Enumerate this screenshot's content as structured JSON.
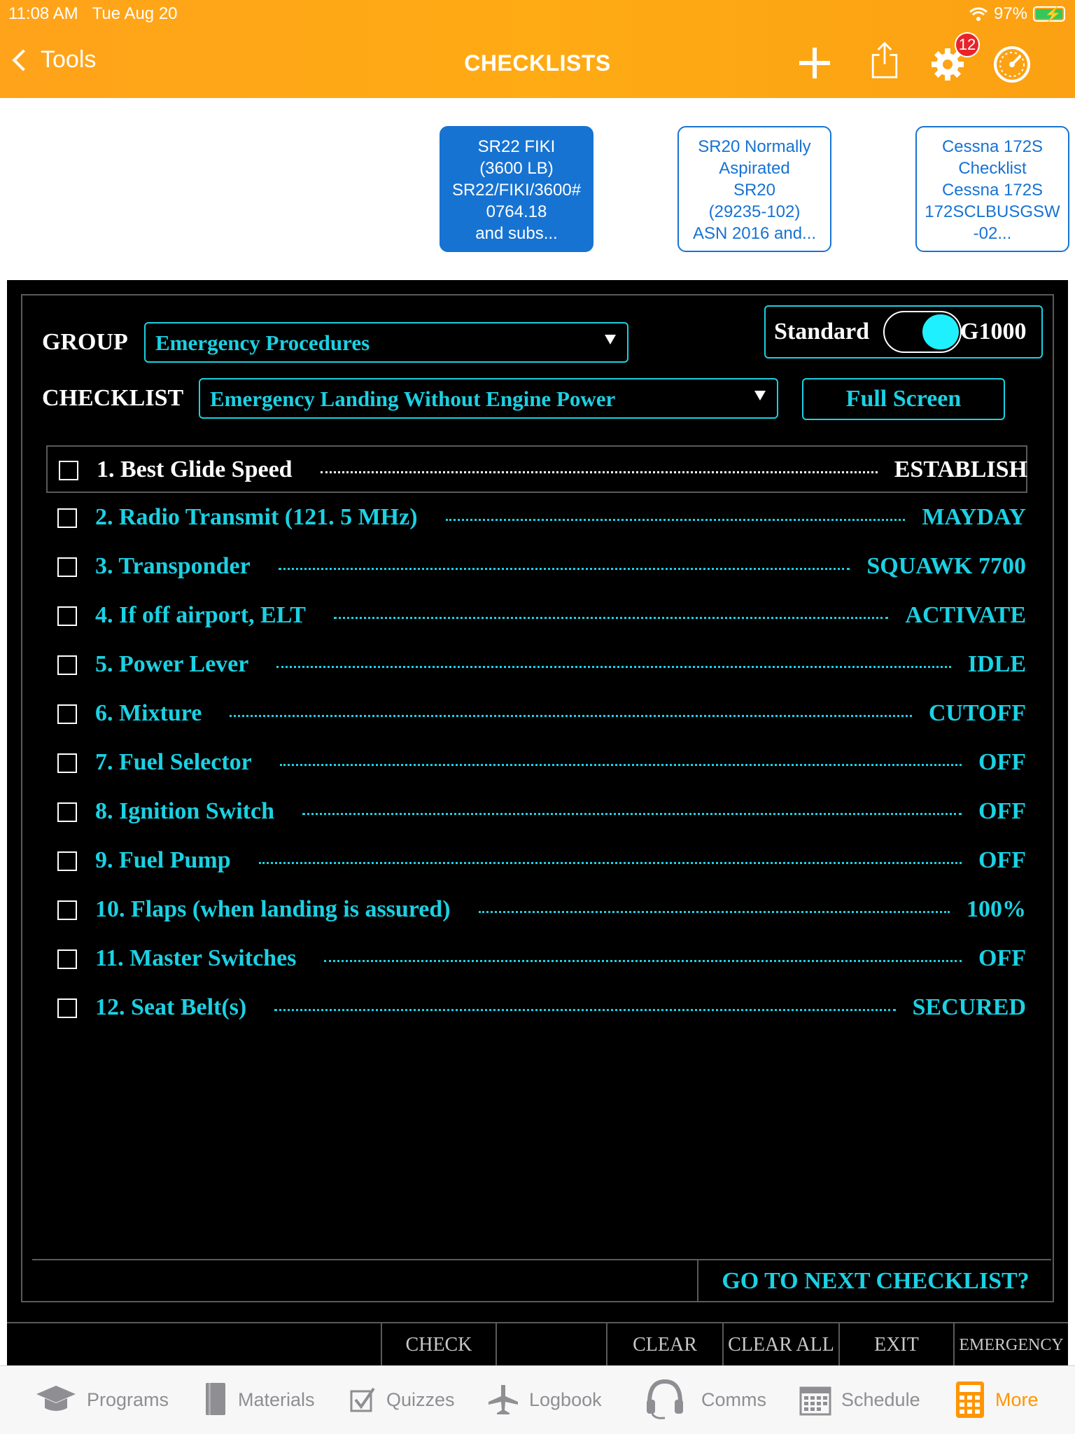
{
  "status": {
    "time": "11:08 AM",
    "date": "Tue Aug 20",
    "battery": "97%"
  },
  "nav": {
    "back_label": "Tools",
    "title": "CHECKLISTS",
    "settings_badge": "12"
  },
  "cards": [
    {
      "lines": [
        "SR22 FIKI",
        "(3600 LB)",
        "SR22/FIKI/3600#",
        "0764.18",
        "and subs..."
      ],
      "active": true
    },
    {
      "lines": [
        "SR20 Normally",
        "Aspirated",
        "SR20",
        "(29235-102)",
        "ASN 2016 and..."
      ],
      "active": false
    },
    {
      "lines": [
        "Cessna 172S",
        "Checklist",
        "Cessna 172S",
        "172SCLBUSGSW",
        "-02..."
      ],
      "active": false
    }
  ],
  "panel": {
    "group_label": "GROUP",
    "group_value": "Emergency Procedures",
    "checklist_label": "CHECKLIST",
    "checklist_value": "Emergency Landing Without Engine Power",
    "toggle_left": "Standard",
    "toggle_right": "G1000",
    "full_screen_label": "Full Screen",
    "items": [
      {
        "name": "1. Best Glide Speed",
        "value": "ESTABLISH",
        "checked": false
      },
      {
        "name": "2. Radio Transmit (121. 5 MHz)",
        "value": "MAYDAY",
        "checked": false
      },
      {
        "name": "3. Transponder",
        "value": "SQUAWK 7700",
        "checked": false
      },
      {
        "name": "4. If off airport, ELT",
        "value": "ACTIVATE",
        "checked": false
      },
      {
        "name": "5. Power Lever",
        "value": "IDLE",
        "checked": false
      },
      {
        "name": "6. Mixture",
        "value": "CUTOFF",
        "checked": false
      },
      {
        "name": "7. Fuel Selector",
        "value": "OFF",
        "checked": false
      },
      {
        "name": "8. Ignition Switch",
        "value": "OFF",
        "checked": false
      },
      {
        "name": "9. Fuel Pump",
        "value": "OFF",
        "checked": false
      },
      {
        "name": "10. Flaps (when landing is assured)",
        "value": "100%",
        "checked": false
      },
      {
        "name": "11. Master Switches",
        "value": "OFF",
        "checked": false
      },
      {
        "name": "12. Seat Belt(s)",
        "value": "SECURED",
        "checked": false
      }
    ],
    "next_checklist_label": "GO TO NEXT CHECKLIST?"
  },
  "actions": {
    "check": "CHECK",
    "clear": "CLEAR",
    "clear_all": "CLEAR ALL",
    "exit": "EXIT",
    "emergency": "EMERGENCY"
  },
  "tabs": [
    {
      "label": "Programs",
      "icon": "graduation-cap-icon"
    },
    {
      "label": "Materials",
      "icon": "book-icon"
    },
    {
      "label": "Quizzes",
      "icon": "checkbox-icon"
    },
    {
      "label": "Logbook",
      "icon": "airplane-icon"
    },
    {
      "label": "Comms",
      "icon": "headset-icon"
    },
    {
      "label": "Schedule",
      "icon": "calendar-icon"
    },
    {
      "label": "More",
      "icon": "calculator-icon",
      "active": true
    }
  ],
  "colors": {
    "accent_orange": "#ffa31a",
    "card_blue": "#1773d2",
    "cyan": "#1bd1e3",
    "active_tab": "#ff9500"
  }
}
